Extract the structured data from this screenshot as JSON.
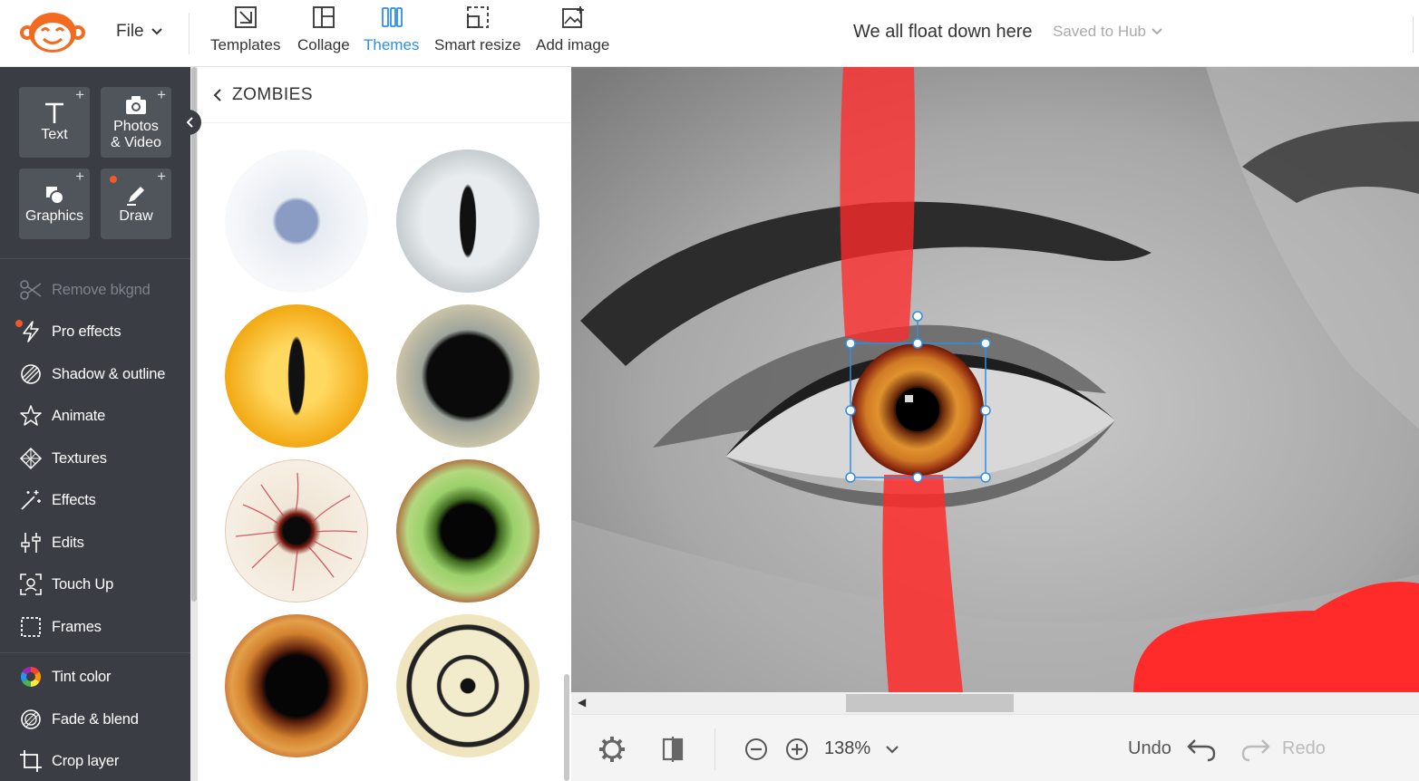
{
  "app": {
    "logo": "monkey-logo",
    "accent_color": "#2d8ee8",
    "brand_color": "#f26b21"
  },
  "topbar": {
    "file_label": "File",
    "tools": [
      {
        "label": "Templates",
        "icon": "templates-icon"
      },
      {
        "label": "Collage",
        "icon": "collage-icon"
      },
      {
        "label": "Themes",
        "icon": "themes-icon",
        "active": true
      },
      {
        "label": "Smart resize",
        "icon": "smart-resize-icon"
      },
      {
        "label": "Add image",
        "icon": "add-image-icon"
      }
    ],
    "document_title": "We all float down here",
    "save_status": "Saved to Hub"
  },
  "sidebar": {
    "tiles": [
      {
        "label": "Text",
        "plus": "+"
      },
      {
        "label": "Photos & Video",
        "plus": "+"
      },
      {
        "label": "Graphics",
        "plus": "+"
      },
      {
        "label": "Draw",
        "plus": "+"
      }
    ],
    "items": [
      {
        "label": "Remove bkgnd",
        "icon": "scissors-icon",
        "disabled": true
      },
      {
        "label": "Pro effects",
        "icon": "lightning-icon"
      },
      {
        "label": "Shadow & outline",
        "icon": "shadow-icon"
      },
      {
        "label": "Animate",
        "icon": "star-icon"
      },
      {
        "label": "Textures",
        "icon": "textures-icon"
      },
      {
        "label": "Effects",
        "icon": "magic-wand-icon"
      },
      {
        "label": "Edits",
        "icon": "sliders-icon"
      },
      {
        "label": "Touch Up",
        "icon": "face-icon"
      },
      {
        "label": "Frames",
        "icon": "frame-icon"
      },
      {
        "label": "Tint color",
        "icon": "color-wheel-icon"
      },
      {
        "label": "Fade & blend",
        "icon": "fade-icon"
      },
      {
        "label": "Crop layer",
        "icon": "crop-icon"
      }
    ]
  },
  "panel": {
    "title": "ZOMBIES",
    "stickers": [
      "blue-iris-eye",
      "white-cat-eye",
      "yellow-cat-eye",
      "black-pupil-eye",
      "bloodshot-eye",
      "green-red-eye",
      "orange-brown-eye",
      "ringed-target-eye"
    ]
  },
  "bottombar": {
    "zoom_level": "138%",
    "undo_label": "Undo",
    "redo_label": "Redo"
  }
}
